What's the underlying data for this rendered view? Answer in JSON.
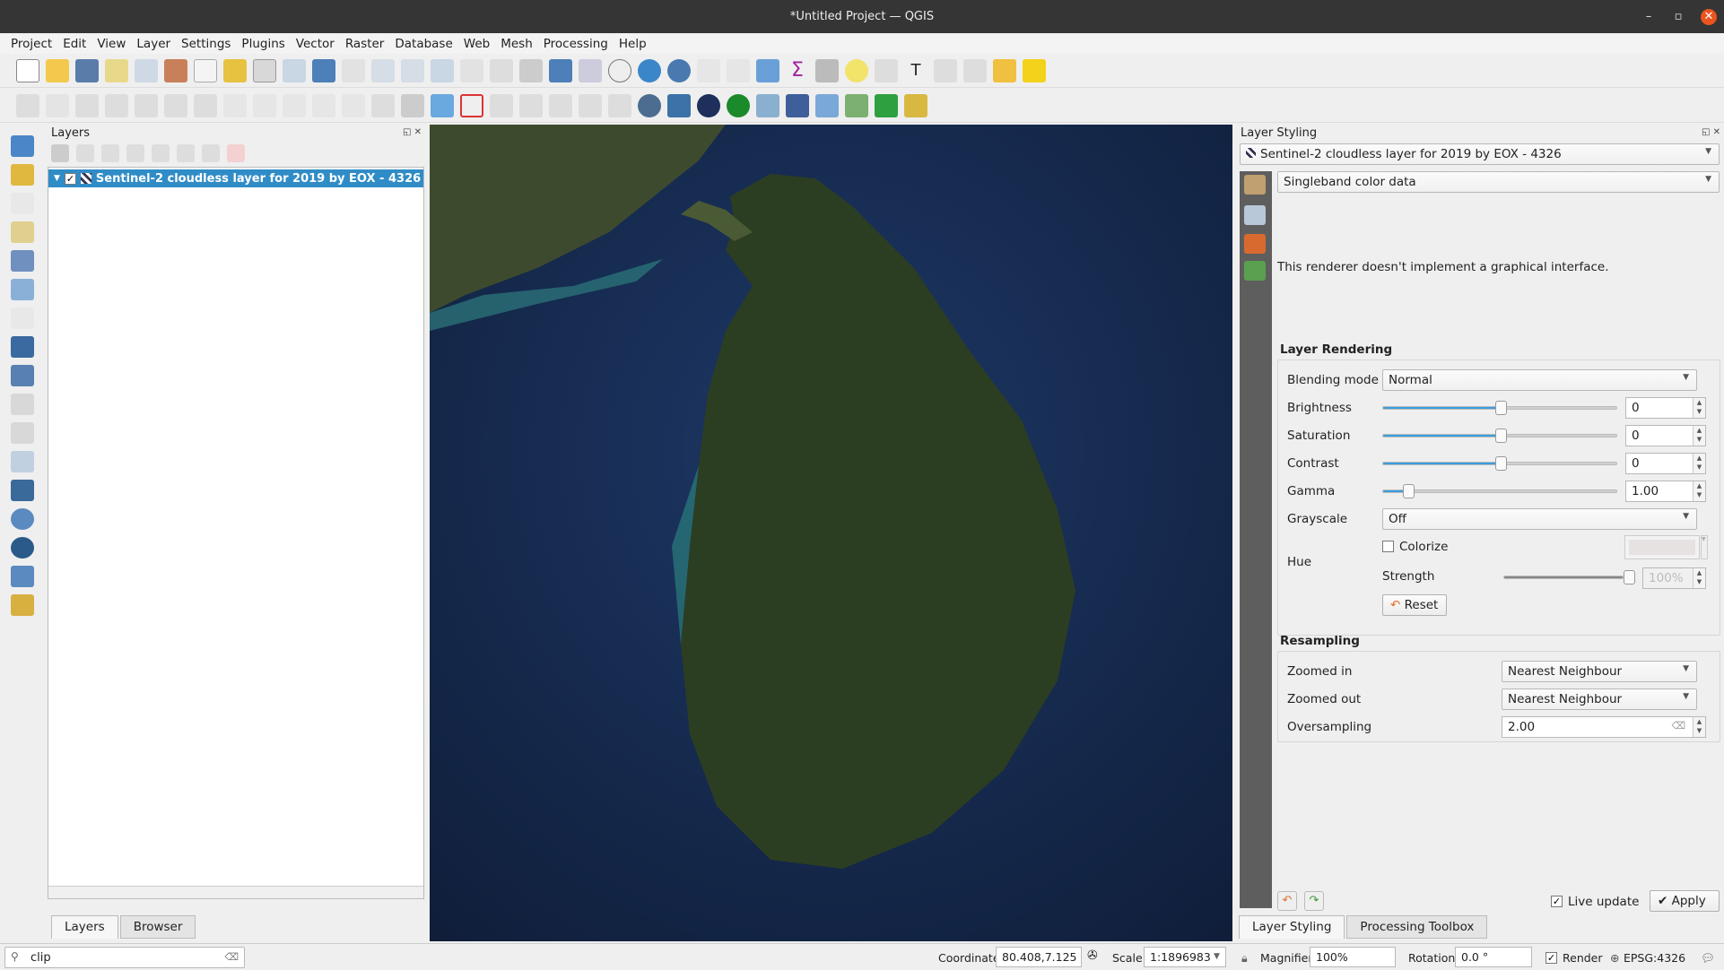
{
  "window": {
    "title": "*Untitled Project — QGIS"
  },
  "menu": [
    "Project",
    "Edit",
    "View",
    "Layer",
    "Settings",
    "Plugins",
    "Vector",
    "Raster",
    "Database",
    "Web",
    "Mesh",
    "Processing",
    "Help"
  ],
  "layers_panel": {
    "title": "Layers",
    "layer_name": "Sentinel-2 cloudless layer for 2019 by EOX - 4326",
    "layer_checked": true,
    "tabs": [
      "Layers",
      "Browser"
    ],
    "active_tab": "Layers"
  },
  "search": {
    "value": "clip"
  },
  "styling": {
    "title": "Layer Styling",
    "layer_select": "Sentinel-2 cloudless layer for 2019 by EOX - 4326",
    "renderer": "Singleband color data",
    "renderer_message": "This renderer doesn't implement a graphical interface.",
    "layer_rendering": {
      "title": "Layer Rendering",
      "blending_mode_label": "Blending mode",
      "blending_mode": "Normal",
      "brightness_label": "Brightness",
      "brightness": "0",
      "saturation_label": "Saturation",
      "saturation": "0",
      "contrast_label": "Contrast",
      "contrast": "0",
      "gamma_label": "Gamma",
      "gamma": "1.00",
      "grayscale_label": "Grayscale",
      "grayscale": "Off",
      "hue_label": "Hue",
      "colorize_label": "Colorize",
      "colorize_checked": false,
      "strength_label": "Strength",
      "strength": "100%",
      "reset_label": "Reset"
    },
    "resampling": {
      "title": "Resampling",
      "zoomed_in_label": "Zoomed in",
      "zoomed_in": "Nearest Neighbour",
      "zoomed_out_label": "Zoomed out",
      "zoomed_out": "Nearest Neighbour",
      "oversampling_label": "Oversampling",
      "oversampling": "2.00"
    },
    "live_update_label": "Live update",
    "live_update_checked": true,
    "apply_label": "Apply",
    "tabs": [
      "Layer Styling",
      "Processing Toolbox"
    ],
    "active_tab": "Layer Styling"
  },
  "statusbar": {
    "coordinate_label": "Coordinate",
    "coordinate": "80.408,7.125",
    "scale_label": "Scale",
    "scale": "1:1896983",
    "magnifier_label": "Magnifier",
    "magnifier": "100%",
    "rotation_label": "Rotation",
    "rotation": "0.0 °",
    "render_label": "Render",
    "render_checked": true,
    "crs": "EPSG:4326"
  },
  "colors": {
    "accent": "#308cc6",
    "slider": "#3a9de0",
    "titlebar": "#353535",
    "ocean": "#14284a",
    "land": "#2c3e22"
  }
}
